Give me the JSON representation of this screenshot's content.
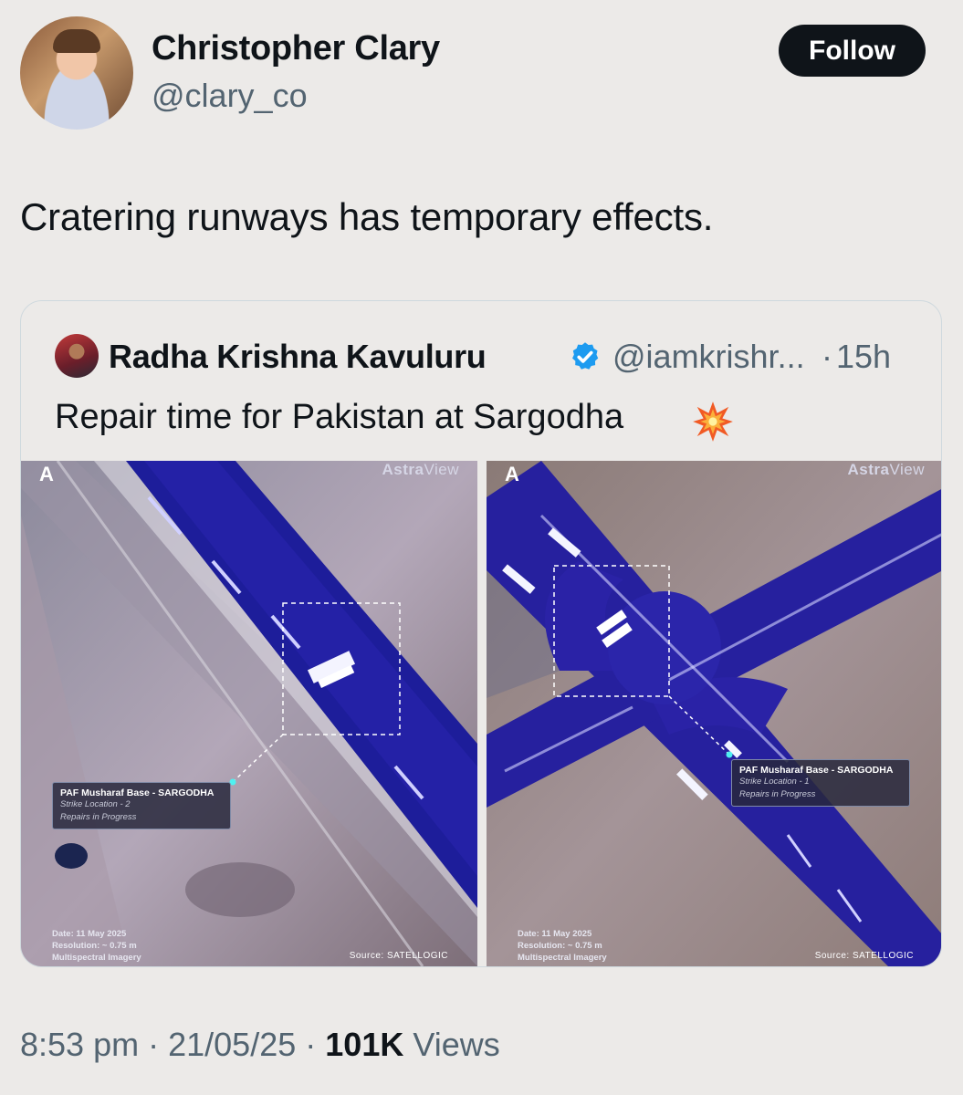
{
  "author": {
    "name": "Christopher Clary",
    "handle": "@clary_co",
    "follow_label": "Follow"
  },
  "tweet": {
    "text": "Cratering runways has temporary effects."
  },
  "quoted": {
    "name": "Radha Krishna Kavuluru",
    "handle": "@iamkrishr...",
    "separator": "·",
    "time": "15h",
    "text": "Repair time for Pakistan at Sargodha",
    "images": [
      {
        "brand_a": "A",
        "brand_stra": "stra",
        "brand_view": "View",
        "callout_title": "PAF Musharaf Base - SARGODHA",
        "callout_loc": "Strike Location - 2",
        "callout_status": "Repairs in Progress",
        "date": "Date: 11 May 2025",
        "resolution": "Resolution: ~ 0.75 m",
        "imagery": "Multispectral Imagery",
        "source": "Source: SATELLOGIC"
      },
      {
        "brand_a": "A",
        "brand_stra": "stra",
        "brand_view": "View",
        "callout_title": "PAF Musharaf Base - SARGODHA",
        "callout_loc": "Strike Location - 1",
        "callout_status": "Repairs in Progress",
        "date": "Date: 11 May 2025",
        "resolution": "Resolution: ~ 0.75 m",
        "imagery": "Multispectral Imagery",
        "source": "Source: SATELLOGIC"
      }
    ]
  },
  "footer": {
    "time": "8:53 pm",
    "sep1": "·",
    "date": "21/05/25",
    "sep2": "·",
    "views_count": "101K",
    "views_label": "Views"
  },
  "icons": {
    "verified": "verified-badge-icon",
    "emoji": "collision-emoji-icon"
  },
  "colors": {
    "follow_bg": "#0f1419",
    "verified": "#1d9bf0",
    "muted": "#536471"
  }
}
